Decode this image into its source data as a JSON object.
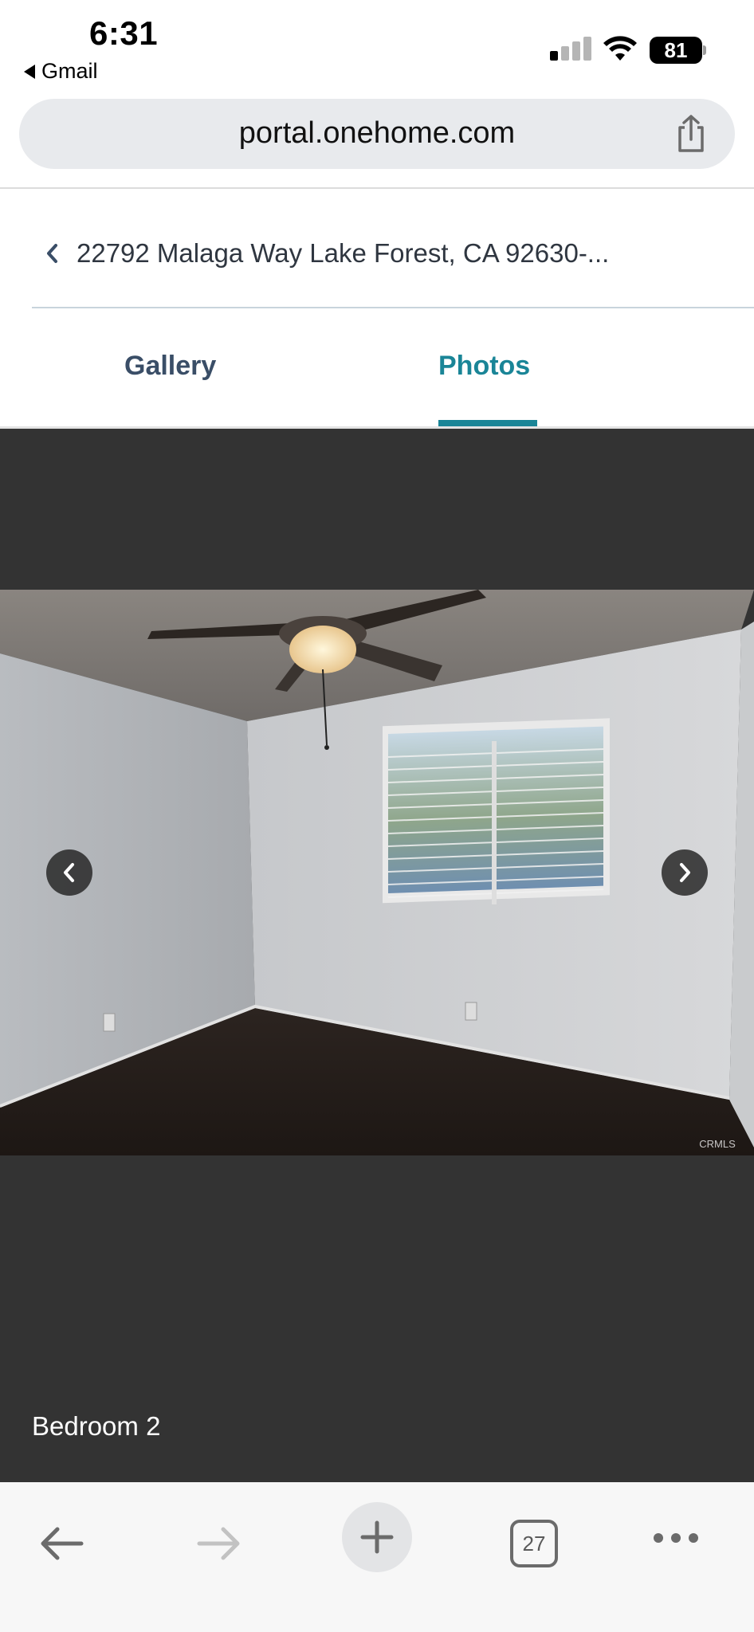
{
  "status_bar": {
    "time": "6:31",
    "back_app": "Gmail",
    "battery_level": "81",
    "signal_bars_active": 1
  },
  "url_bar": {
    "url": "portal.onehome.com"
  },
  "listing": {
    "address": "22792 Malaga Way Lake Forest, CA 92630-..."
  },
  "tabs": [
    {
      "label": "Gallery",
      "active": false
    },
    {
      "label": "Photos",
      "active": true
    }
  ],
  "viewer": {
    "photo_caption": "Bedroom 2",
    "watermark": "CRMLS"
  },
  "toolbar": {
    "tab_count": "27"
  },
  "colors": {
    "accent": "#1a8597",
    "tab_inactive": "#3a4e67",
    "viewer_bg": "#333333"
  },
  "icons": [
    "back-triangle-icon",
    "cellular-signal-icon",
    "wifi-icon",
    "battery-icon",
    "share-icon",
    "chevron-left-icon",
    "arrow-left-icon",
    "arrow-right-icon",
    "chevron-right-icon",
    "plus-icon",
    "more-icon"
  ]
}
